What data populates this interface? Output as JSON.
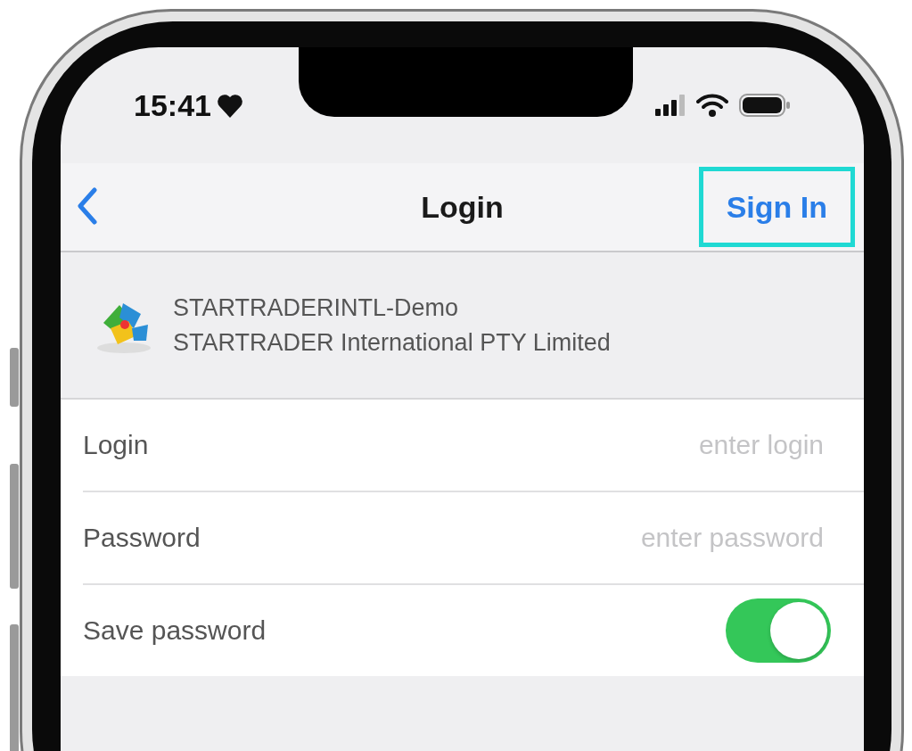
{
  "status_bar": {
    "time": "15:41"
  },
  "nav_bar": {
    "title": "Login",
    "action": {
      "label": "Sign In",
      "highlighted": true
    }
  },
  "server": {
    "name": "STARTRADERINTL-Demo",
    "company": "STARTRADER International PTY Limited"
  },
  "fields": [
    {
      "kind": "input",
      "label": "Login",
      "placeholder": "enter login"
    },
    {
      "kind": "input",
      "label": "Password",
      "placeholder": "enter password"
    },
    {
      "kind": "toggle",
      "label": "Save password",
      "on": true
    }
  ]
}
